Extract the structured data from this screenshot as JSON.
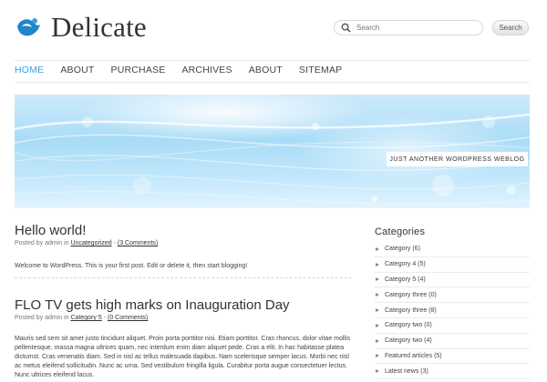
{
  "header": {
    "site_title": "Delicate",
    "search_placeholder": "Search",
    "search_button": "Search"
  },
  "nav": {
    "items": [
      "HOME",
      "ABOUT",
      "PURCHASE",
      "ARCHIVES",
      "ABOUT",
      "SITEMAP"
    ],
    "active": "HOME"
  },
  "banner": {
    "tagline": "JUST ANOTHER WORDPRESS WEBLOG"
  },
  "posts": [
    {
      "title": "Hello world!",
      "meta_prefix": "Posted by admin in",
      "category": "Uncategorized",
      "comments": "(3 Comments)",
      "body": "Welcome to WordPress. This is your first post. Edit or delete it, then start blogging!"
    },
    {
      "title": "FLO TV gets high marks on Inauguration Day",
      "meta_prefix": "Posted by admin in",
      "category": "Category 5",
      "comments": "(0 Comments)",
      "body": "Mauris sed sem sit amet justo tincidunt aliquet. Proin porta porttitor nisi. Etiam porttitor. Cras rhoncus, dolor vitae mollis pellentesque, massa magna ultrices quam, nec interdum enim diam aliquet pede. Cras a elit. In hac habitasse platea dictumst. Cras venenatis diam. Sed in nisl ac tellus malesuada dapibus. Nam scelerisque semper lacus. Morbi nec nisl ac metus eleifend sollicitudin. Nunc ac urna. Sed vestibulum fringilla ligula. Curabitur porta augue consectetuer lectus. Nunc ultrices eleifend lacus."
    }
  ],
  "sidebar": {
    "categories_title": "Categories",
    "categories": [
      "Category (6)",
      "Category 4 (5)",
      "Category 5 (4)",
      "Category three (0)",
      "Category three (8)",
      "Category two (0)",
      "Category two (4)",
      "Featured articles (5)",
      "Latest news (3)"
    ]
  },
  "colors": {
    "accent": "#3aa1d6",
    "logo_blue": "#1f86c9"
  }
}
